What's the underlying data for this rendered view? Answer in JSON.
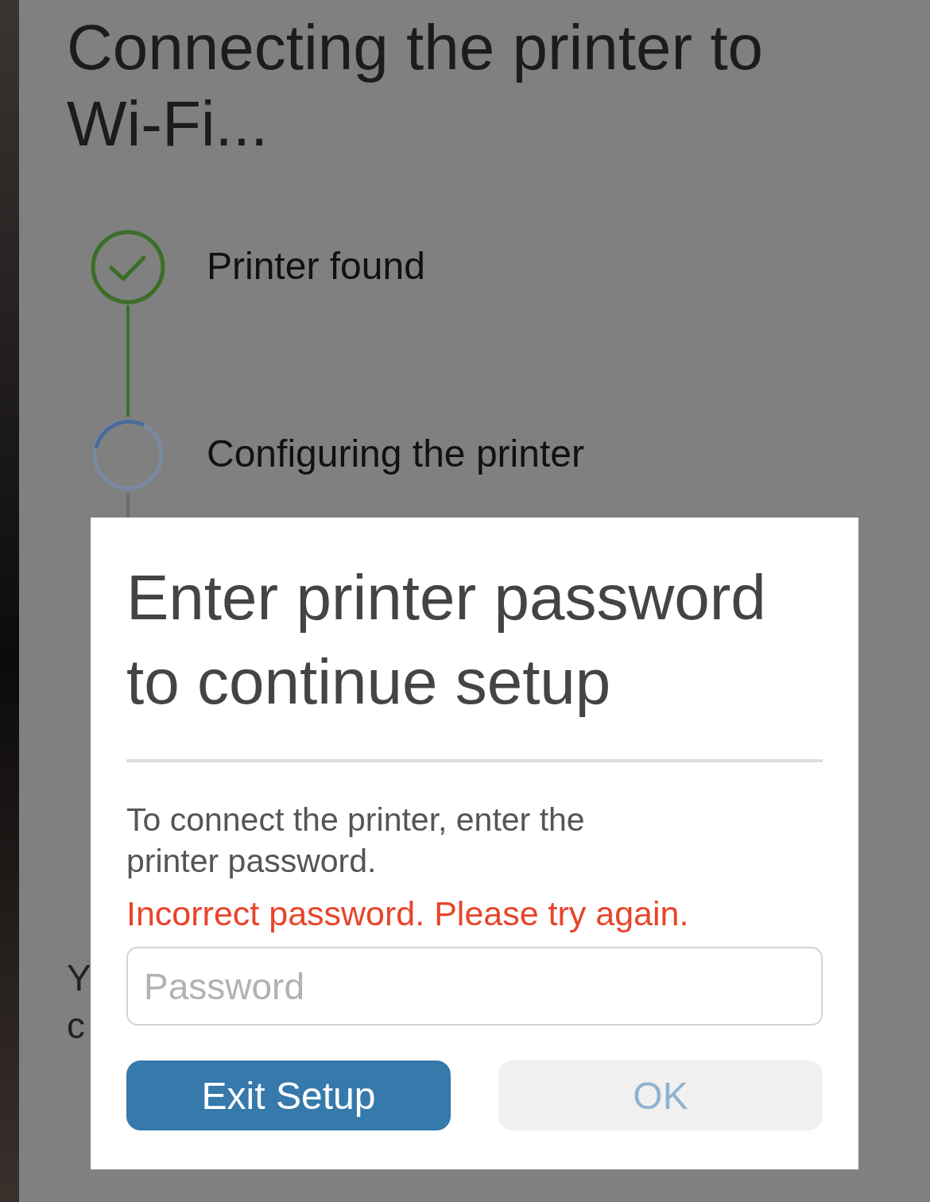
{
  "title": "Connecting the printer to Wi-Fi...",
  "steps": [
    {
      "label": "Printer found",
      "done": true
    },
    {
      "label": "Configuring the printer",
      "done": false
    }
  ],
  "background_text": [
    "Y",
    "c"
  ],
  "dialog": {
    "title": "Enter printer password to continue setup",
    "message": "To connect the printer, enter the printer password.",
    "error": "Incorrect password. Please try again.",
    "password": {
      "placeholder": "Password"
    },
    "buttons": [
      {
        "label": "Exit Setup",
        "kind": "primary",
        "disabled": false
      },
      {
        "label": "OK",
        "kind": "secondary",
        "disabled": true
      }
    ]
  }
}
